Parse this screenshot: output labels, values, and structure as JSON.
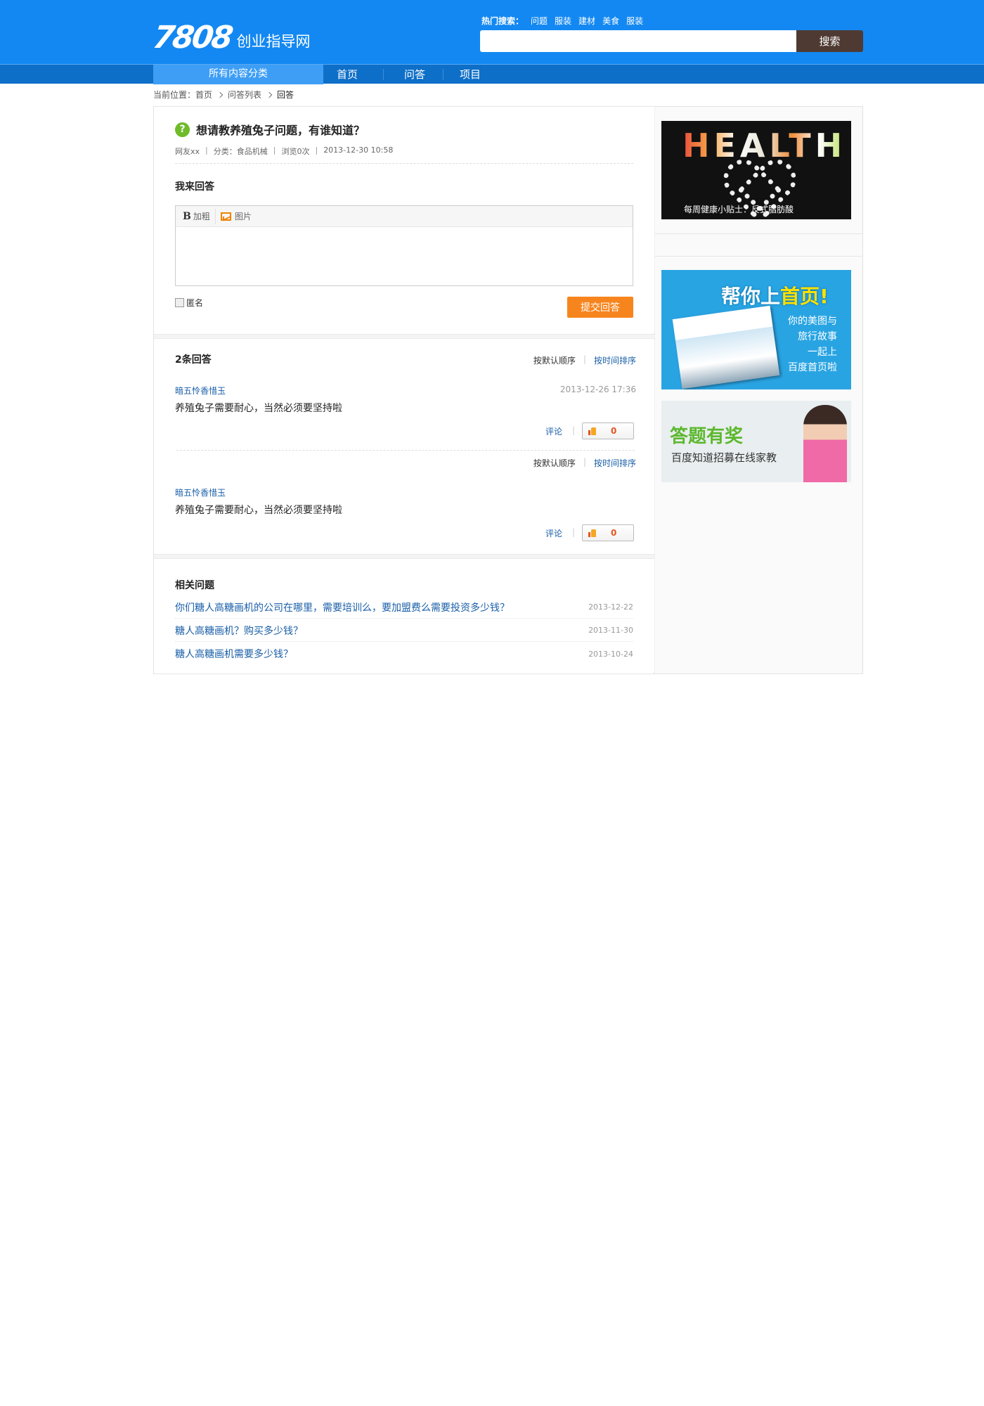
{
  "header": {
    "logo_number": "7808",
    "logo_text": "创业指导网",
    "hot_label": "热门搜索：",
    "hot_items": [
      "问题",
      "服装",
      "建材",
      "美食",
      "服装"
    ],
    "search_placeholder": "",
    "search_button": "搜索"
  },
  "nav": {
    "all_categories": "所有内容分类",
    "items": [
      "首页",
      "问答",
      "项目"
    ]
  },
  "breadcrumb": {
    "prefix": "当前位置：",
    "items": [
      "首页",
      "问答列表",
      "回答"
    ]
  },
  "question": {
    "icon": "?",
    "title": "想请教养殖兔子问题，有谁知道？",
    "meta": [
      "网友xx",
      "分类：食品机械",
      "浏览0次",
      "2013-12-30 10:58"
    ]
  },
  "reply": {
    "heading": "我来回答",
    "bold_label": "B",
    "bold_text": "加粗",
    "image_text": "图片",
    "anonymous": "匿名",
    "submit": "提交回答"
  },
  "answers": {
    "count_label": "2条回答",
    "sort_default": "按默认顺序",
    "sort_time": "按时间排序",
    "items": [
      {
        "user": "暗五怜香惜玉",
        "time": "2013-12-26 17:36",
        "body": "养殖兔子需要耐心，当然必须要坚持啦",
        "comment": "评论",
        "likes": "0"
      },
      {
        "user": "暗五怜香惜玉",
        "time": "",
        "body": "养殖兔子需要耐心，当然必须要坚持啦",
        "comment": "评论",
        "likes": "0"
      }
    ]
  },
  "related": {
    "heading": "相关问题",
    "items": [
      {
        "title": "你们糖人高糖画机的公司在哪里，需要培训么，要加盟费么需要投资多少钱？",
        "date": "2013-12-22"
      },
      {
        "title": "糖人高糖画机？购买多少钱？",
        "date": "2013-11-30"
      },
      {
        "title": "糖人高糖画机需要多少钱？",
        "date": "2013-10-24"
      }
    ]
  },
  "sidebar": {
    "ad1_word": "HEALTH",
    "ad1_caption": "每周健康小贴士：反式脂肪酸",
    "ad2_title_a": "帮你上",
    "ad2_title_b": "首页!",
    "ad2_lines": [
      "你的美图与",
      "旅行故事",
      "一起上",
      "百度首页啦"
    ],
    "ad3_title": "答题有奖",
    "ad3_sub": "百度知道招募在线家教"
  },
  "colors": {
    "header_bg": "#1388f2",
    "nav_bg": "#0e6fc8",
    "submit_bg": "#f7851e",
    "search_btn": "#4f3a33"
  }
}
